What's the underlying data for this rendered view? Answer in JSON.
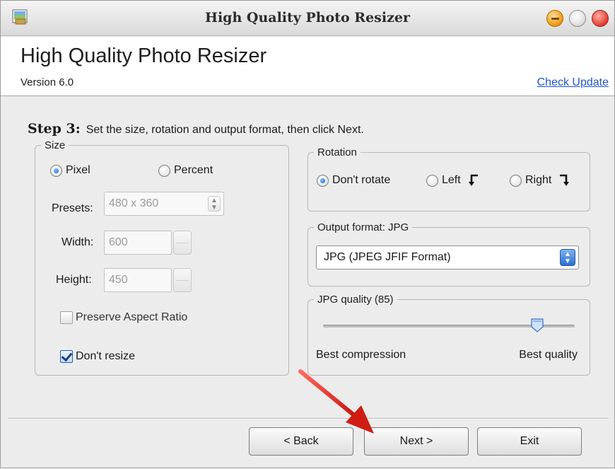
{
  "window": {
    "title": "High Quality Photo Resizer",
    "app_icon": "photo-app-icon"
  },
  "header": {
    "heading": "High Quality Photo Resizer",
    "version": "Version 6.0",
    "check_update": "Check Update"
  },
  "step": {
    "label": "Step 3:",
    "instruction": "Set the size, rotation and output format, then click Next."
  },
  "size": {
    "legend": "Size",
    "unit_options": [
      {
        "label": "Pixel",
        "checked": true
      },
      {
        "label": "Percent",
        "checked": false
      }
    ],
    "presets_label": "Presets:",
    "presets_value": "480 x 360",
    "width_label": "Width:",
    "width_value": "600",
    "height_label": "Height:",
    "height_value": "450",
    "preserve_aspect_label": "Preserve Aspect Ratio",
    "preserve_aspect_checked": false,
    "dont_resize_label": "Don't resize",
    "dont_resize_checked": true
  },
  "rotation": {
    "legend": "Rotation",
    "options": [
      {
        "label": "Don't rotate",
        "checked": true,
        "icon": ""
      },
      {
        "label": "Left",
        "checked": false,
        "icon": "↲"
      },
      {
        "label": "Right",
        "checked": false,
        "icon": "↳"
      }
    ]
  },
  "output_format": {
    "legend": "Output format: JPG",
    "selected": "JPG (JPEG JFIF Format)"
  },
  "quality": {
    "legend": "JPG quality (85)",
    "value": 85,
    "min_label": "Best compression",
    "max_label": "Best quality"
  },
  "buttons": {
    "back": "< Back",
    "next": "Next >",
    "exit": "Exit"
  },
  "colors": {
    "link": "#1f56c9",
    "annotation_arrow": "#d9231c",
    "radio_checked": "#1a64c8"
  }
}
